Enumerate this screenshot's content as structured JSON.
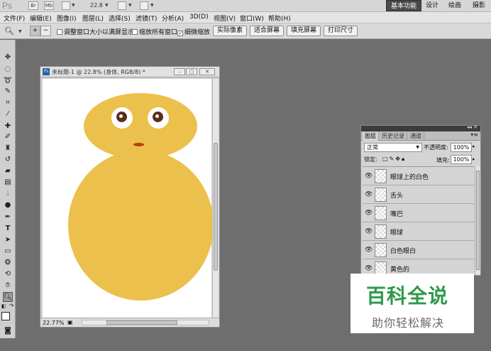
{
  "app": {
    "logo": "Ps",
    "bridge_label": "Br",
    "minibridge_label": "Mb",
    "zoom_level": "22.8",
    "workspaces": [
      "基本功能",
      "设计",
      "绘画",
      "摄影"
    ],
    "active_workspace": "基本功能"
  },
  "menu": {
    "items": [
      "文件(F)",
      "编辑(E)",
      "图像(I)",
      "图层(L)",
      "选择(S)",
      "滤镜(T)",
      "分析(A)",
      "3D(D)",
      "视图(V)",
      "窗口(W)",
      "帮助(H)"
    ]
  },
  "options": {
    "resize_windows": "调整窗口大小以满屏显示",
    "zoom_all_windows": "缩放所有窗口",
    "scrubby_zoom": "细微缩放",
    "scrubby_checked": "✓",
    "buttons": [
      "实际像素",
      "适合屏幕",
      "填充屏幕",
      "打印尺寸"
    ]
  },
  "document": {
    "title": "未标题-1 @ 22.8% (身体, RGB/8) *",
    "zoom_status": "22.77%",
    "artwork_colors": {
      "yellow": "#ecc04c",
      "pupil": "#5a2e1a",
      "mouth": "#b7400f"
    }
  },
  "layers_panel": {
    "tabs": [
      "图层",
      "历史记录",
      "通道"
    ],
    "active_tab": "图层",
    "blend_mode": "正常",
    "opacity_label": "不透明度:",
    "opacity_value": "100%",
    "lock_label": "锁定:",
    "fill_label": "填充:",
    "fill_value": "100%",
    "layers": [
      {
        "name": "眼球上的白色"
      },
      {
        "name": "舌头"
      },
      {
        "name": "嘴巴"
      },
      {
        "name": "眼球"
      },
      {
        "name": "白色眼白"
      },
      {
        "name": "黄色的"
      }
    ]
  },
  "watermark": {
    "title": "百科全说",
    "subtitle": "助你轻松解决"
  }
}
